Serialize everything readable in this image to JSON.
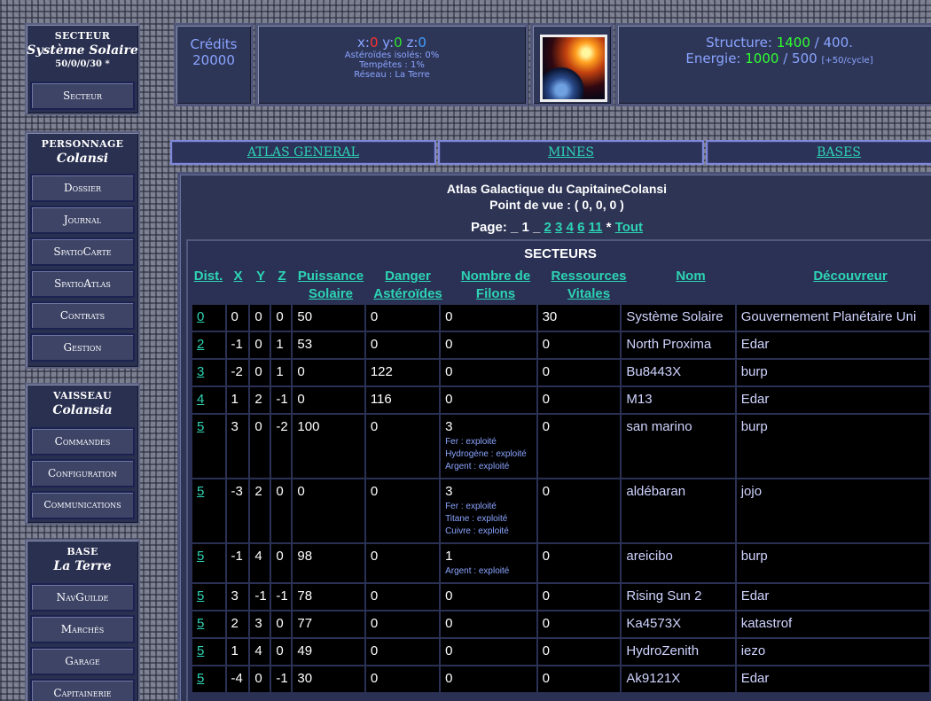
{
  "sidebar": {
    "secteur": {
      "category": "SECTEUR",
      "name": "Système Solaire",
      "coords": "50/0/0/30 *",
      "buttons": [
        "Secteur"
      ]
    },
    "personnage": {
      "category": "PERSONNAGE",
      "name": "Colansi",
      "buttons": [
        "Dossier",
        "Journal",
        "SpatioCarte",
        "SpatioAtlas",
        "Contrats",
        "Gestion"
      ]
    },
    "vaisseau": {
      "category": "VAISSEAU",
      "name": "Colansia",
      "buttons": [
        "Commandes",
        "Configuration",
        "Communications"
      ]
    },
    "base": {
      "category": "BASE",
      "name": "La Terre",
      "buttons": [
        "NavGuilde",
        "Marchés",
        "Garage",
        "Capitainerie"
      ]
    }
  },
  "top": {
    "credits_label": "Crédits",
    "credits_value": "20000",
    "pos": {
      "x_label": "x:",
      "x": "0",
      "y_label": "y:",
      "y": "0",
      "z_label": "z:",
      "z": "0",
      "line1": "Astéroïdes isolés: 0%",
      "line2": "Tempêtes : 1%",
      "line3": "Réseau : La Terre"
    },
    "structure_label": "Structure:",
    "structure_value": "1400",
    "structure_max": "/ 400.",
    "energie_label": "Energie:",
    "energie_value": "1000",
    "energie_max": "/ 500",
    "energie_note": "[+50/cycle]",
    "colors": {
      "x": "#ff3030",
      "y": "#30e030",
      "z": "#40a0ff",
      "green": "#30ff30"
    }
  },
  "tabs": [
    "ATLAS GENERAL",
    "MINES",
    "BASES"
  ],
  "atlas": {
    "title": "Atlas Galactique du CapitaineColansi",
    "pov": "Point de vue : ( 0, 0, 0 )",
    "page_label": "Page: _ 1 _",
    "pages": [
      "2",
      "3",
      "4",
      "6",
      "11"
    ],
    "star": "*",
    "all": "Tout",
    "section": "SECTEURS",
    "columns": [
      [
        "Dist."
      ],
      [
        "X"
      ],
      [
        "Y"
      ],
      [
        "Z"
      ],
      [
        "Puissance",
        "Solaire"
      ],
      [
        "Danger",
        "Astéroïdes"
      ],
      [
        "Nombre de",
        "Filons"
      ],
      [
        "Ressources",
        "Vitales"
      ],
      [
        "Nom"
      ],
      [
        "Découvreur"
      ]
    ],
    "rows": [
      {
        "d": "0",
        "x": "0",
        "y": "0",
        "z": "0",
        "p": "50",
        "a": "0",
        "f": "0",
        "fil": [],
        "r": "30",
        "n": "Système Solaire",
        "dc": "Gouvernement Planétaire Uni"
      },
      {
        "d": "2",
        "x": "-1",
        "y": "0",
        "z": "1",
        "p": "53",
        "a": "0",
        "f": "0",
        "fil": [],
        "r": "0",
        "n": "North Proxima",
        "dc": "Edar"
      },
      {
        "d": "3",
        "x": "-2",
        "y": "0",
        "z": "1",
        "p": "0",
        "a": "122",
        "f": "0",
        "fil": [],
        "r": "0",
        "n": "Bu8443X",
        "dc": "burp"
      },
      {
        "d": "4",
        "x": "1",
        "y": "2",
        "z": "-1",
        "p": "0",
        "a": "116",
        "f": "0",
        "fil": [],
        "r": "0",
        "n": "M13",
        "dc": "Edar"
      },
      {
        "d": "5",
        "x": "3",
        "y": "0",
        "z": "-2",
        "p": "100",
        "a": "0",
        "f": "3",
        "fil": [
          "Fer : exploité",
          "Hydrogène : exploité",
          "Argent : exploité"
        ],
        "r": "0",
        "n": "san marino",
        "dc": "burp"
      },
      {
        "d": "5",
        "x": "-3",
        "y": "2",
        "z": "0",
        "p": "0",
        "a": "0",
        "f": "3",
        "fil": [
          "Fer : exploité",
          "Titane : exploité",
          "Cuivre : exploité"
        ],
        "r": "0",
        "n": "aldébaran",
        "dc": "jojo"
      },
      {
        "d": "5",
        "x": "-1",
        "y": "4",
        "z": "0",
        "p": "98",
        "a": "0",
        "f": "1",
        "fil": [
          "Argent : exploité"
        ],
        "r": "0",
        "n": "areicibo",
        "dc": "burp"
      },
      {
        "d": "5",
        "x": "3",
        "y": "-1",
        "z": "-1",
        "p": "78",
        "a": "0",
        "f": "0",
        "fil": [],
        "r": "0",
        "n": "Rising Sun 2",
        "dc": "Edar"
      },
      {
        "d": "5",
        "x": "2",
        "y": "3",
        "z": "0",
        "p": "77",
        "a": "0",
        "f": "0",
        "fil": [],
        "r": "0",
        "n": "Ka4573X",
        "dc": "katastrof"
      },
      {
        "d": "5",
        "x": "1",
        "y": "4",
        "z": "0",
        "p": "49",
        "a": "0",
        "f": "0",
        "fil": [],
        "r": "0",
        "n": "HydroZenith",
        "dc": "iezo"
      },
      {
        "d": "5",
        "x": "-4",
        "y": "0",
        "z": "-1",
        "p": "30",
        "a": "0",
        "f": "0",
        "fil": [],
        "r": "0",
        "n": "Ak9121X",
        "dc": "Edar"
      }
    ]
  }
}
